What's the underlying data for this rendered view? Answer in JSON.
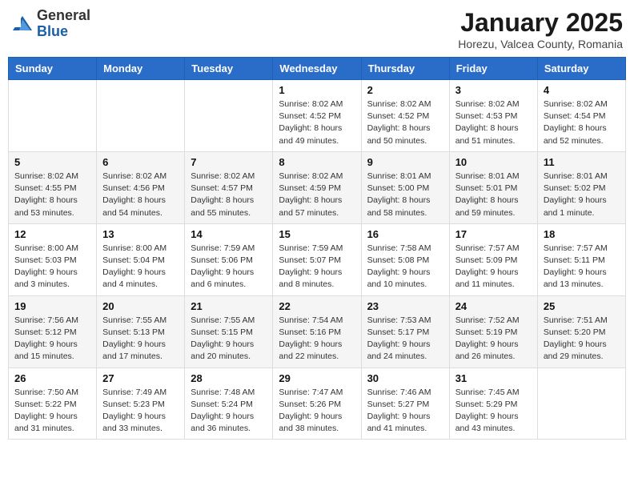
{
  "header": {
    "logo_general": "General",
    "logo_blue": "Blue",
    "month_title": "January 2025",
    "location": "Horezu, Valcea County, Romania"
  },
  "weekdays": [
    "Sunday",
    "Monday",
    "Tuesday",
    "Wednesday",
    "Thursday",
    "Friday",
    "Saturday"
  ],
  "weeks": [
    [
      {
        "day": "",
        "info": ""
      },
      {
        "day": "",
        "info": ""
      },
      {
        "day": "",
        "info": ""
      },
      {
        "day": "1",
        "info": "Sunrise: 8:02 AM\nSunset: 4:52 PM\nDaylight: 8 hours and 49 minutes."
      },
      {
        "day": "2",
        "info": "Sunrise: 8:02 AM\nSunset: 4:52 PM\nDaylight: 8 hours and 50 minutes."
      },
      {
        "day": "3",
        "info": "Sunrise: 8:02 AM\nSunset: 4:53 PM\nDaylight: 8 hours and 51 minutes."
      },
      {
        "day": "4",
        "info": "Sunrise: 8:02 AM\nSunset: 4:54 PM\nDaylight: 8 hours and 52 minutes."
      }
    ],
    [
      {
        "day": "5",
        "info": "Sunrise: 8:02 AM\nSunset: 4:55 PM\nDaylight: 8 hours and 53 minutes."
      },
      {
        "day": "6",
        "info": "Sunrise: 8:02 AM\nSunset: 4:56 PM\nDaylight: 8 hours and 54 minutes."
      },
      {
        "day": "7",
        "info": "Sunrise: 8:02 AM\nSunset: 4:57 PM\nDaylight: 8 hours and 55 minutes."
      },
      {
        "day": "8",
        "info": "Sunrise: 8:02 AM\nSunset: 4:59 PM\nDaylight: 8 hours and 57 minutes."
      },
      {
        "day": "9",
        "info": "Sunrise: 8:01 AM\nSunset: 5:00 PM\nDaylight: 8 hours and 58 minutes."
      },
      {
        "day": "10",
        "info": "Sunrise: 8:01 AM\nSunset: 5:01 PM\nDaylight: 8 hours and 59 minutes."
      },
      {
        "day": "11",
        "info": "Sunrise: 8:01 AM\nSunset: 5:02 PM\nDaylight: 9 hours and 1 minute."
      }
    ],
    [
      {
        "day": "12",
        "info": "Sunrise: 8:00 AM\nSunset: 5:03 PM\nDaylight: 9 hours and 3 minutes."
      },
      {
        "day": "13",
        "info": "Sunrise: 8:00 AM\nSunset: 5:04 PM\nDaylight: 9 hours and 4 minutes."
      },
      {
        "day": "14",
        "info": "Sunrise: 7:59 AM\nSunset: 5:06 PM\nDaylight: 9 hours and 6 minutes."
      },
      {
        "day": "15",
        "info": "Sunrise: 7:59 AM\nSunset: 5:07 PM\nDaylight: 9 hours and 8 minutes."
      },
      {
        "day": "16",
        "info": "Sunrise: 7:58 AM\nSunset: 5:08 PM\nDaylight: 9 hours and 10 minutes."
      },
      {
        "day": "17",
        "info": "Sunrise: 7:57 AM\nSunset: 5:09 PM\nDaylight: 9 hours and 11 minutes."
      },
      {
        "day": "18",
        "info": "Sunrise: 7:57 AM\nSunset: 5:11 PM\nDaylight: 9 hours and 13 minutes."
      }
    ],
    [
      {
        "day": "19",
        "info": "Sunrise: 7:56 AM\nSunset: 5:12 PM\nDaylight: 9 hours and 15 minutes."
      },
      {
        "day": "20",
        "info": "Sunrise: 7:55 AM\nSunset: 5:13 PM\nDaylight: 9 hours and 17 minutes."
      },
      {
        "day": "21",
        "info": "Sunrise: 7:55 AM\nSunset: 5:15 PM\nDaylight: 9 hours and 20 minutes."
      },
      {
        "day": "22",
        "info": "Sunrise: 7:54 AM\nSunset: 5:16 PM\nDaylight: 9 hours and 22 minutes."
      },
      {
        "day": "23",
        "info": "Sunrise: 7:53 AM\nSunset: 5:17 PM\nDaylight: 9 hours and 24 minutes."
      },
      {
        "day": "24",
        "info": "Sunrise: 7:52 AM\nSunset: 5:19 PM\nDaylight: 9 hours and 26 minutes."
      },
      {
        "day": "25",
        "info": "Sunrise: 7:51 AM\nSunset: 5:20 PM\nDaylight: 9 hours and 29 minutes."
      }
    ],
    [
      {
        "day": "26",
        "info": "Sunrise: 7:50 AM\nSunset: 5:22 PM\nDaylight: 9 hours and 31 minutes."
      },
      {
        "day": "27",
        "info": "Sunrise: 7:49 AM\nSunset: 5:23 PM\nDaylight: 9 hours and 33 minutes."
      },
      {
        "day": "28",
        "info": "Sunrise: 7:48 AM\nSunset: 5:24 PM\nDaylight: 9 hours and 36 minutes."
      },
      {
        "day": "29",
        "info": "Sunrise: 7:47 AM\nSunset: 5:26 PM\nDaylight: 9 hours and 38 minutes."
      },
      {
        "day": "30",
        "info": "Sunrise: 7:46 AM\nSunset: 5:27 PM\nDaylight: 9 hours and 41 minutes."
      },
      {
        "day": "31",
        "info": "Sunrise: 7:45 AM\nSunset: 5:29 PM\nDaylight: 9 hours and 43 minutes."
      },
      {
        "day": "",
        "info": ""
      }
    ]
  ]
}
